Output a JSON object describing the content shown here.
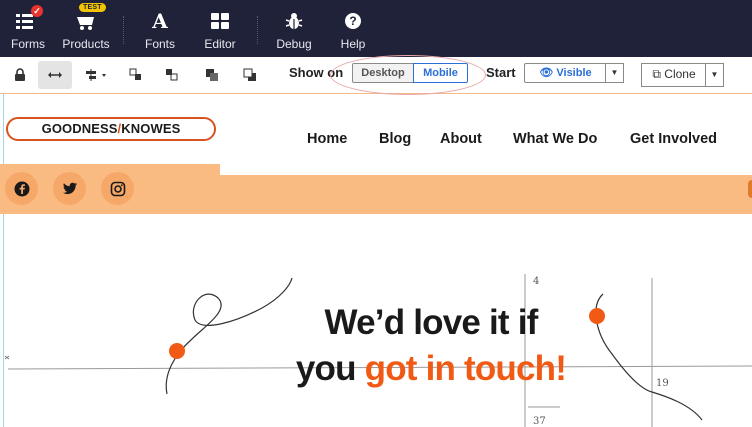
{
  "appbar": {
    "tools": [
      {
        "label": "Forms",
        "icon": "forms-icon"
      },
      {
        "label": "Products",
        "icon": "products-icon",
        "badge": "TEST"
      },
      {
        "label": "Fonts",
        "icon": "fonts-icon"
      },
      {
        "label": "Editor",
        "icon": "editor-grid-icon"
      },
      {
        "label": "Debug",
        "icon": "bug-icon"
      },
      {
        "label": "Help",
        "icon": "help-icon"
      }
    ],
    "fonts_glyph": "A",
    "help_glyph": "?"
  },
  "toolbar": {
    "show_on_label": "Show on",
    "desktop_label": "Desktop",
    "mobile_label": "Mobile",
    "start_label": "Start",
    "visible_label": "Visible",
    "clone_label": "Clone"
  },
  "site": {
    "logo": {
      "left": "GOODNESS",
      "slash": "/",
      "right": "KNOWES"
    },
    "nav": [
      "Home",
      "Blog",
      "About",
      "What We Do",
      "Get Involved"
    ],
    "social": [
      "facebook-icon",
      "twitter-icon",
      "instagram-icon"
    ],
    "headline": {
      "line1": "We’d love it if",
      "line2_plain": "you ",
      "line2_accent": "got in touch!"
    },
    "sketch_numbers": [
      "4",
      "19",
      "37"
    ]
  },
  "colors": {
    "appbar_bg": "#1f2238",
    "brand_orange": "#f05a14",
    "social_band": "#f9bb82",
    "active_blue": "#2a6fd6"
  }
}
